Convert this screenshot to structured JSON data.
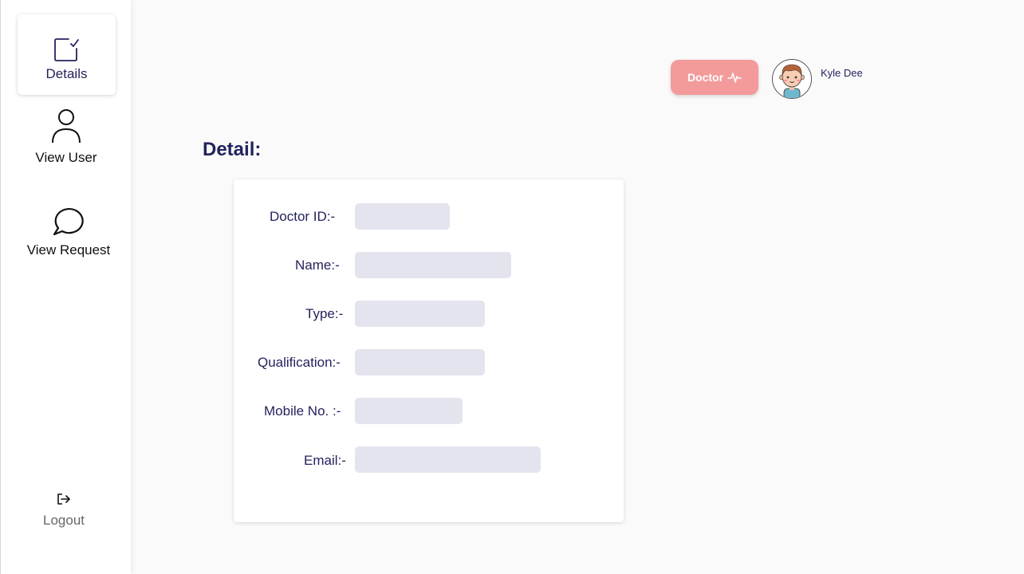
{
  "sidebar": {
    "items": [
      {
        "label": "Details",
        "icon": "edit-square-icon",
        "active": true
      },
      {
        "label": "View User",
        "icon": "user-icon",
        "active": false
      },
      {
        "label": "View Request",
        "icon": "chat-bubble-icon",
        "active": false
      }
    ],
    "logout": {
      "label": "Logout",
      "icon": "logout-icon"
    }
  },
  "header": {
    "role_badge": {
      "label": "Doctor",
      "icon": "heartbeat-icon",
      "color": "#f39a9a"
    },
    "user_name": "Kyle Dee",
    "avatar_icon": "boy-avatar-icon"
  },
  "main": {
    "title": "Detail:",
    "fields": [
      {
        "label": "Doctor ID:-",
        "value": ""
      },
      {
        "label": "Name:-",
        "value": ""
      },
      {
        "label": "Type:-",
        "value": ""
      },
      {
        "label": "Qualification:-",
        "value": ""
      },
      {
        "label": "Mobile No. :-",
        "value": ""
      },
      {
        "label": "Email:-",
        "value": ""
      }
    ]
  },
  "colors": {
    "accent": "#23235e",
    "badge": "#f39a9a",
    "field_placeholder": "#e4e4ef",
    "background": "#fafafa"
  }
}
